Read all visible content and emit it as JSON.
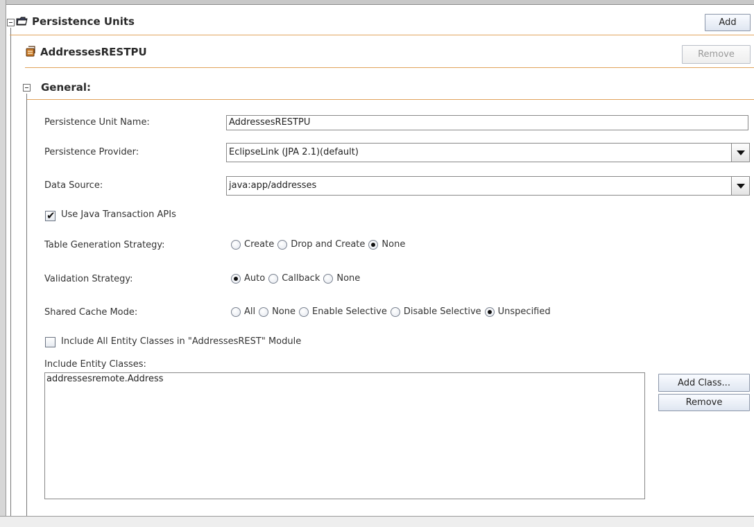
{
  "persistence_units": {
    "title": "Persistence Units",
    "add_label": "Add"
  },
  "unit": {
    "name": "AddressesRESTPU",
    "remove_label": "Remove"
  },
  "general": {
    "title": "General:",
    "unit_name_label": "Persistence Unit Name:",
    "unit_name_value": "AddressesRESTPU",
    "provider_label": "Persistence Provider:",
    "provider_value": "EclipseLink (JPA 2.1)(default)",
    "datasource_label": "Data Source:",
    "datasource_value": "java:app/addresses",
    "jta_label": "Use Java Transaction APIs",
    "jta_checked": true,
    "table_gen_label": "Table Generation Strategy:",
    "table_gen_options": [
      "Create",
      "Drop and Create",
      "None"
    ],
    "table_gen_selected": "None",
    "validation_label": "Validation Strategy:",
    "validation_options": [
      "Auto",
      "Callback",
      "None"
    ],
    "validation_selected": "Auto",
    "cache_label": "Shared Cache Mode:",
    "cache_options": [
      "All",
      "None",
      "Enable Selective",
      "Disable Selective",
      "Unspecified"
    ],
    "cache_selected": "Unspecified",
    "include_all_label": "Include All Entity Classes in \"AddressesREST\" Module",
    "include_all_checked": false,
    "entity_classes_label": "Include Entity Classes:",
    "entity_classes": [
      "addressesremote.Address"
    ],
    "add_class_label": "Add Class...",
    "remove_class_label": "Remove"
  },
  "icons": {
    "persistence_units": "folder-icon",
    "unit": "persistence-unit-icon"
  },
  "colors": {
    "accent_line": "#e0a25a",
    "button_border": "#8a95a8"
  }
}
